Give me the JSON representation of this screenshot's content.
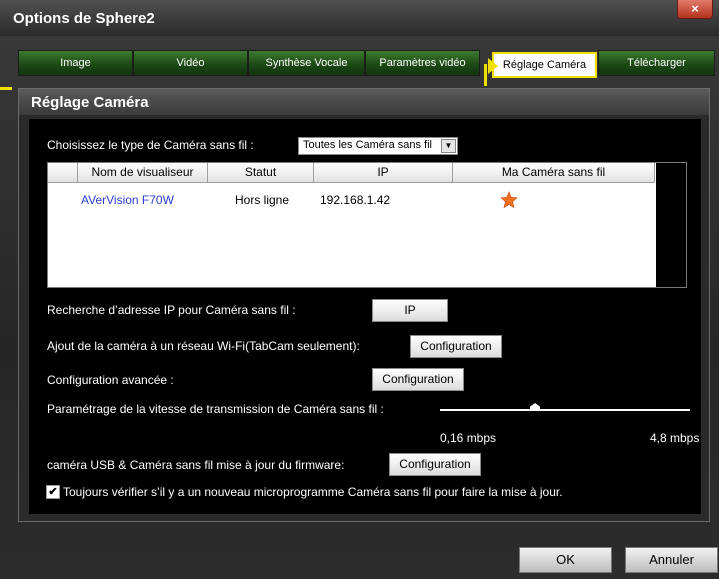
{
  "window": {
    "title": "Options de Sphere2",
    "close_glyph": "×"
  },
  "tabs": [
    {
      "label": "Image"
    },
    {
      "label": "Vidéo"
    },
    {
      "label": "Synthèse Vocale"
    },
    {
      "label": "Paramètres vidéo"
    },
    {
      "label": "Réglage Caméra"
    },
    {
      "label": "Télécharger"
    }
  ],
  "panel": {
    "title": "Réglage Caméra"
  },
  "camera_type": {
    "label": "Choisissez le type de Caméra sans fil :",
    "selected": "Toutes les Caméra sans fil"
  },
  "table": {
    "headers": [
      "Nom de visualiseur",
      "Statut",
      "IP",
      "Ma Caméra sans fil"
    ],
    "rows": [
      {
        "name": "AVerVision F70W",
        "status": "Hors ligne",
        "ip": "192.168.1.42",
        "favorite_icon": "star-icon"
      }
    ]
  },
  "ip_search": {
    "label": "Recherche d’adresse IP pour Caméra sans fil :",
    "button": "IP"
  },
  "wifi": {
    "label": "Ajout de la caméra à un réseau Wi-Fi(TabCam seulement):",
    "button": "Configuration"
  },
  "advanced": {
    "label": "Configuration avancée :",
    "button": "Configuration"
  },
  "speed": {
    "label": "Paramétrage de la vitesse de transmission de Caméra sans fil :",
    "min_label": "0,16 mbps",
    "max_label": "4,8 mbps"
  },
  "firmware": {
    "label": "caméra USB & Caméra sans fil mise à jour du firmware:",
    "button": "Configuration"
  },
  "auto_check": {
    "checked": true,
    "check_glyph": "✔",
    "label": "Toujours vérifier s’il y a un nouveau microprogramme Caméra sans fil pour faire la mise à jour."
  },
  "footer": {
    "ok": "OK",
    "cancel": "Annuler"
  },
  "colors": {
    "tab_green": "#2f6a22",
    "highlight_yellow": "#f0e000",
    "link_blue": "#2a3fd0",
    "star_orange": "#f07020"
  }
}
